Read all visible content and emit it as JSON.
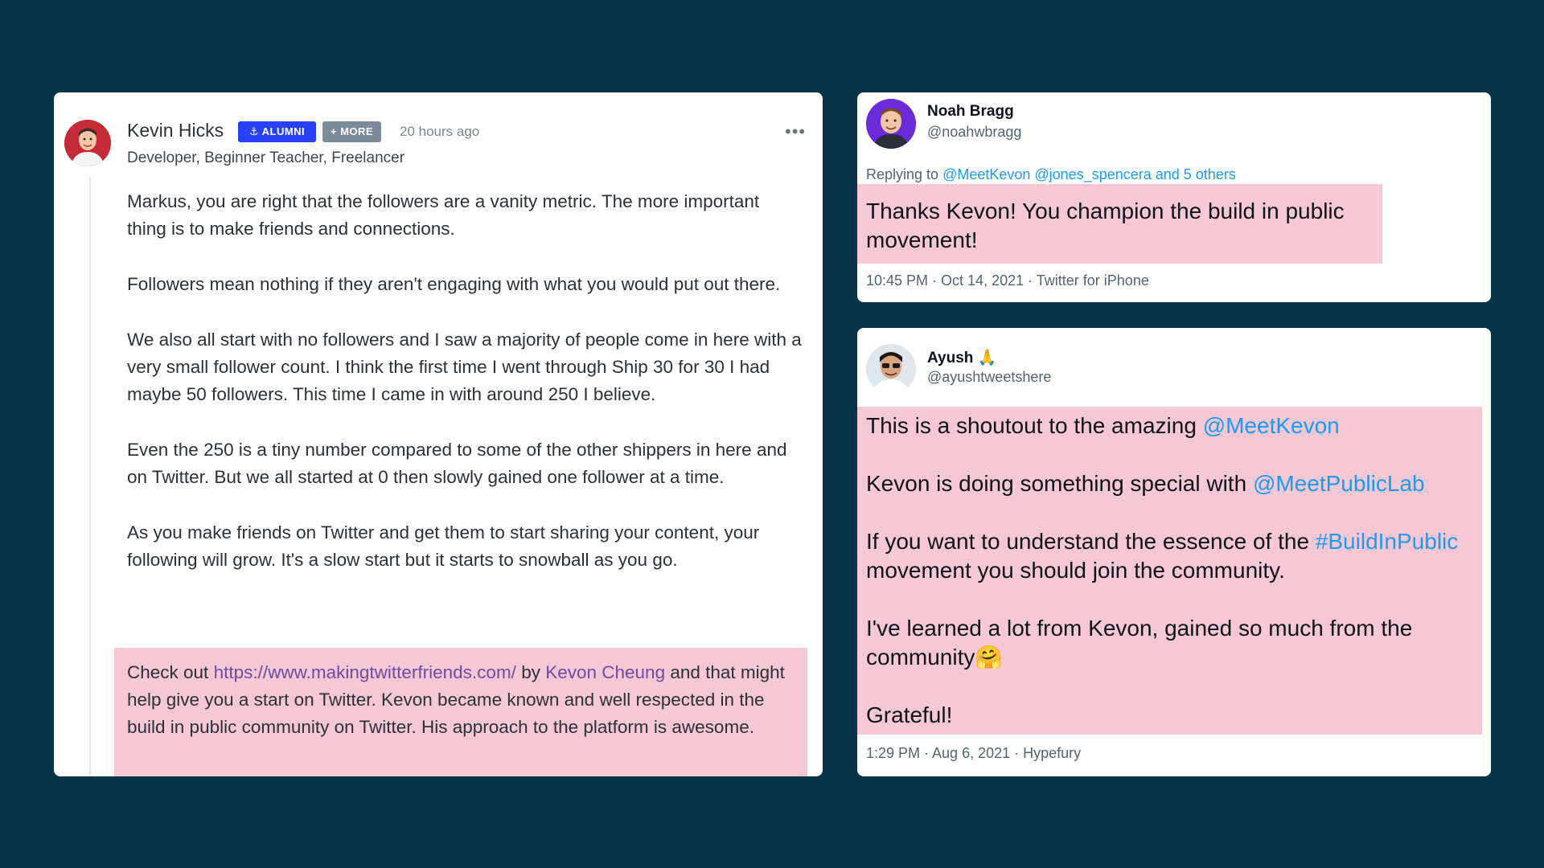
{
  "forum_post": {
    "author": "Kevin Hicks",
    "badge_alumni": "⚓ ALUMNI",
    "badge_more": "+ MORE",
    "timestamp": "20 hours ago",
    "subtitle": "Developer, Beginner Teacher, Freelancer",
    "paragraphs": [
      "Markus, you are right that the followers are a vanity metric. The more important thing is to make friends and connections.",
      "Followers mean nothing if they aren't engaging with what you would put out there.",
      "We also all start with no followers and I saw a majority of people come in here with a very small follower count. I think the first time I went through Ship 30 for 30 I had maybe 50 followers. This time I came in with around 250 I believe.",
      "Even the 250 is a tiny number compared to some of the other shippers in here and on Twitter. But we all started at 0 then slowly gained one follower at a time.",
      "As you make friends on Twitter and get them to start sharing your content, your following will grow. It's a slow start but it starts to snowball as you go."
    ],
    "highlight": {
      "prefix": "Check out ",
      "link": "https://www.makingtwitterfriends.com/",
      "by": " by ",
      "person": "Kevon Cheung",
      "suffix": " and that might help give you a start on Twitter. Kevon became known and well respected in the build in public community on Twitter. His approach to the platform is awesome."
    },
    "more_icon": "ellipsis-icon"
  },
  "tweet1": {
    "name": "Noah Bragg",
    "handle": "@noahwbragg",
    "replying_prefix": "Replying to ",
    "replying_to": "@MeetKevon @jones_spencera and 5 others",
    "text": "Thanks Kevon! You champion the build in public movement!",
    "meta": "10:45 PM · Oct 14, 2021 · Twitter for iPhone"
  },
  "tweet2": {
    "name": "Ayush 🙏",
    "handle": "@ayushtweetshere",
    "line1_text": "This is a shoutout to the amazing ",
    "line1_mention": "@MeetKevon",
    "line2_text": "Kevon is doing something special with ",
    "line2_mention": "@MeetPublicLab",
    "line3_text": "If you want to understand the essence of the ",
    "line3_hashtag": "#BuildInPublic",
    "line3_suffix": " movement you should join the community.",
    "line4_text": "I've learned a lot from Kevon, gained so much from the community",
    "line4_emoji": "🤗",
    "line5_text": "Grateful!",
    "meta": "1:29 PM · Aug 6, 2021 · Hypefury"
  },
  "colors": {
    "background": "#073447",
    "highlight": "#f6c8d6",
    "twitter_blue": "#1d9bf0",
    "alumni_badge": "#2742f5"
  }
}
